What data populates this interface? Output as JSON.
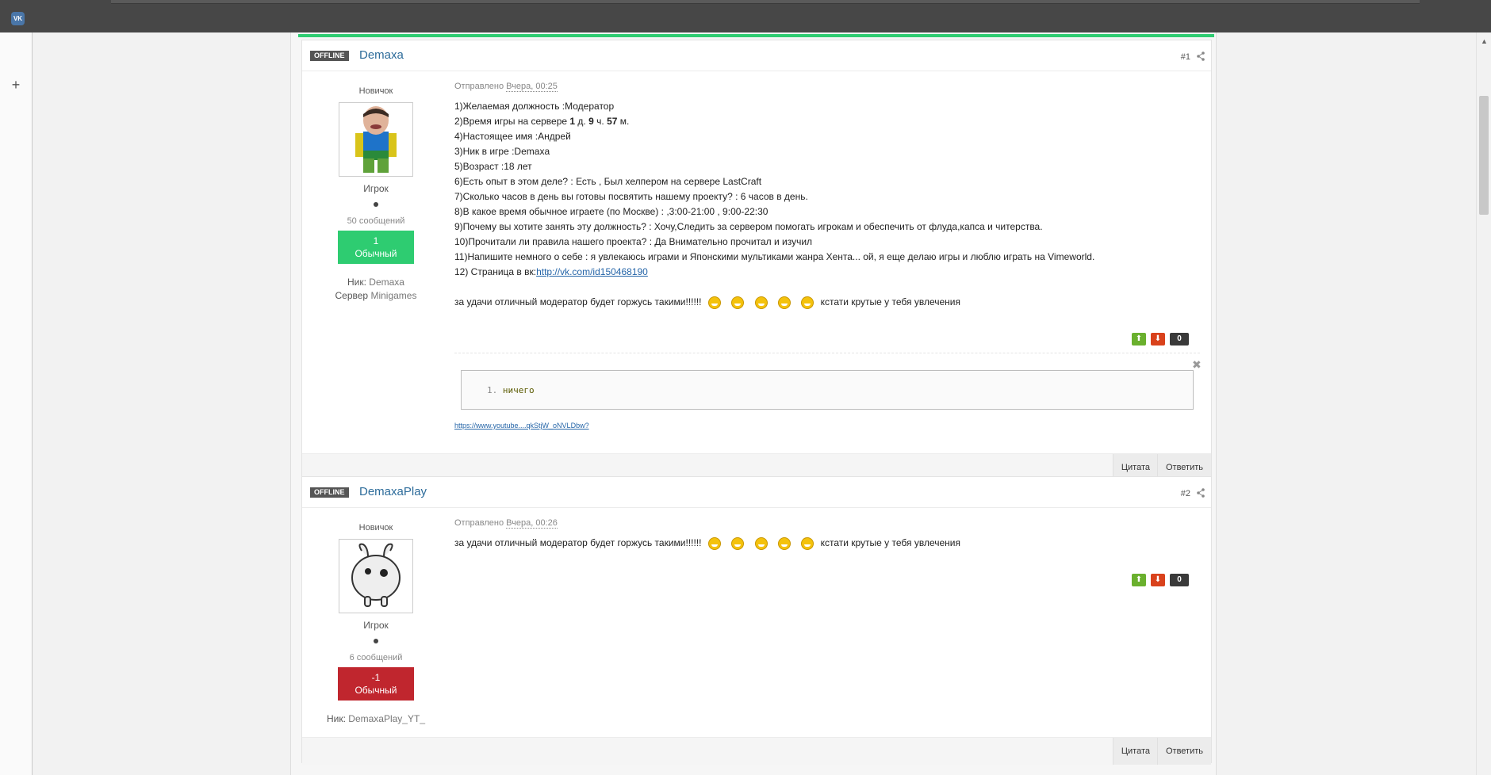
{
  "browser": {
    "vk_logo": "VK",
    "new_tab": "+"
  },
  "posts": [
    {
      "status": "OFFLINE",
      "author": "Demaxa",
      "number": "#1",
      "rank": "Новичок",
      "group": "Игрок",
      "post_count": "50 сообщений",
      "rep_value": "1",
      "rep_label": "Обычный",
      "nick_label": "Ник:",
      "nick_value": "Demaxa",
      "server_label": "Сервер",
      "server_value": "Minigames",
      "sent_label": "Отправлено",
      "sent_date": "Вчера, 00:25",
      "lines": [
        "1)Желаемая должность :Модератор",
        "4)Настоящее имя :Андрей",
        "3)Ник в игре :Demaxa",
        "5)Возраст :18 лет",
        "6)Есть опыт в этом деле? : Есть , Был хелпером на сервере LastCraft",
        "7)Сколько часов в день вы готовы посвятить нашему проекту? : 6 часов в день.",
        "8)В какое время обычное играете (по Москве) : ,3:00-21:00 , 9:00-22:30",
        "9)Почему вы хотите занять эту должность? : Хочу,Следить за сервером помогать игрокам и обеспечить от флуда,капса и читерства.",
        "10)Прочитали ли правила нашего проекта? : Да Внимательно прочитал и изучил",
        "11)Напишите немного о себе : я увлекаюсь играми и Японскими мультиками жанра Хента... ой, я еще делаю игры и люблю играть на Vimeworld."
      ],
      "playtime": {
        "prefix": "2)Время игры на сервере ",
        "d": "1",
        "d_unit": " д. ",
        "h": "9",
        "h_unit": " ч. ",
        "m": "57",
        "m_unit": " м."
      },
      "vk_page_label": "12) Страница в вк:",
      "vk_link": "http://vk.com/id150468190",
      "quote_prefix": "за удачи отличный модератор будет горжусь такими!!!!!!",
      "quote_suffix": "кстати крутые у тебя увлечения",
      "votes": "0",
      "code_line_number": "1.",
      "code_text": "ничего",
      "youtube_link": "https://www.youtube....qkStjW_oNVLDbw?",
      "quote_btn": "Цитата",
      "reply_btn": "Ответить"
    },
    {
      "status": "OFFLINE",
      "author": "DemaxaPlay",
      "number": "#2",
      "rank": "Новичок",
      "group": "Игрок",
      "post_count": "6 сообщений",
      "rep_value": "-1",
      "rep_label": "Обычный",
      "nick_label": "Ник:",
      "nick_value": "DemaxaPlay_YT_",
      "sent_label": "Отправлено",
      "sent_date": "Вчера, 00:26",
      "quote_prefix": "за удачи отличный модератор будет горжусь такими!!!!!!",
      "quote_suffix": "кстати крутые у тебя увлечения",
      "votes": "0",
      "quote_btn": "Цитата",
      "reply_btn": "Ответить"
    }
  ]
}
